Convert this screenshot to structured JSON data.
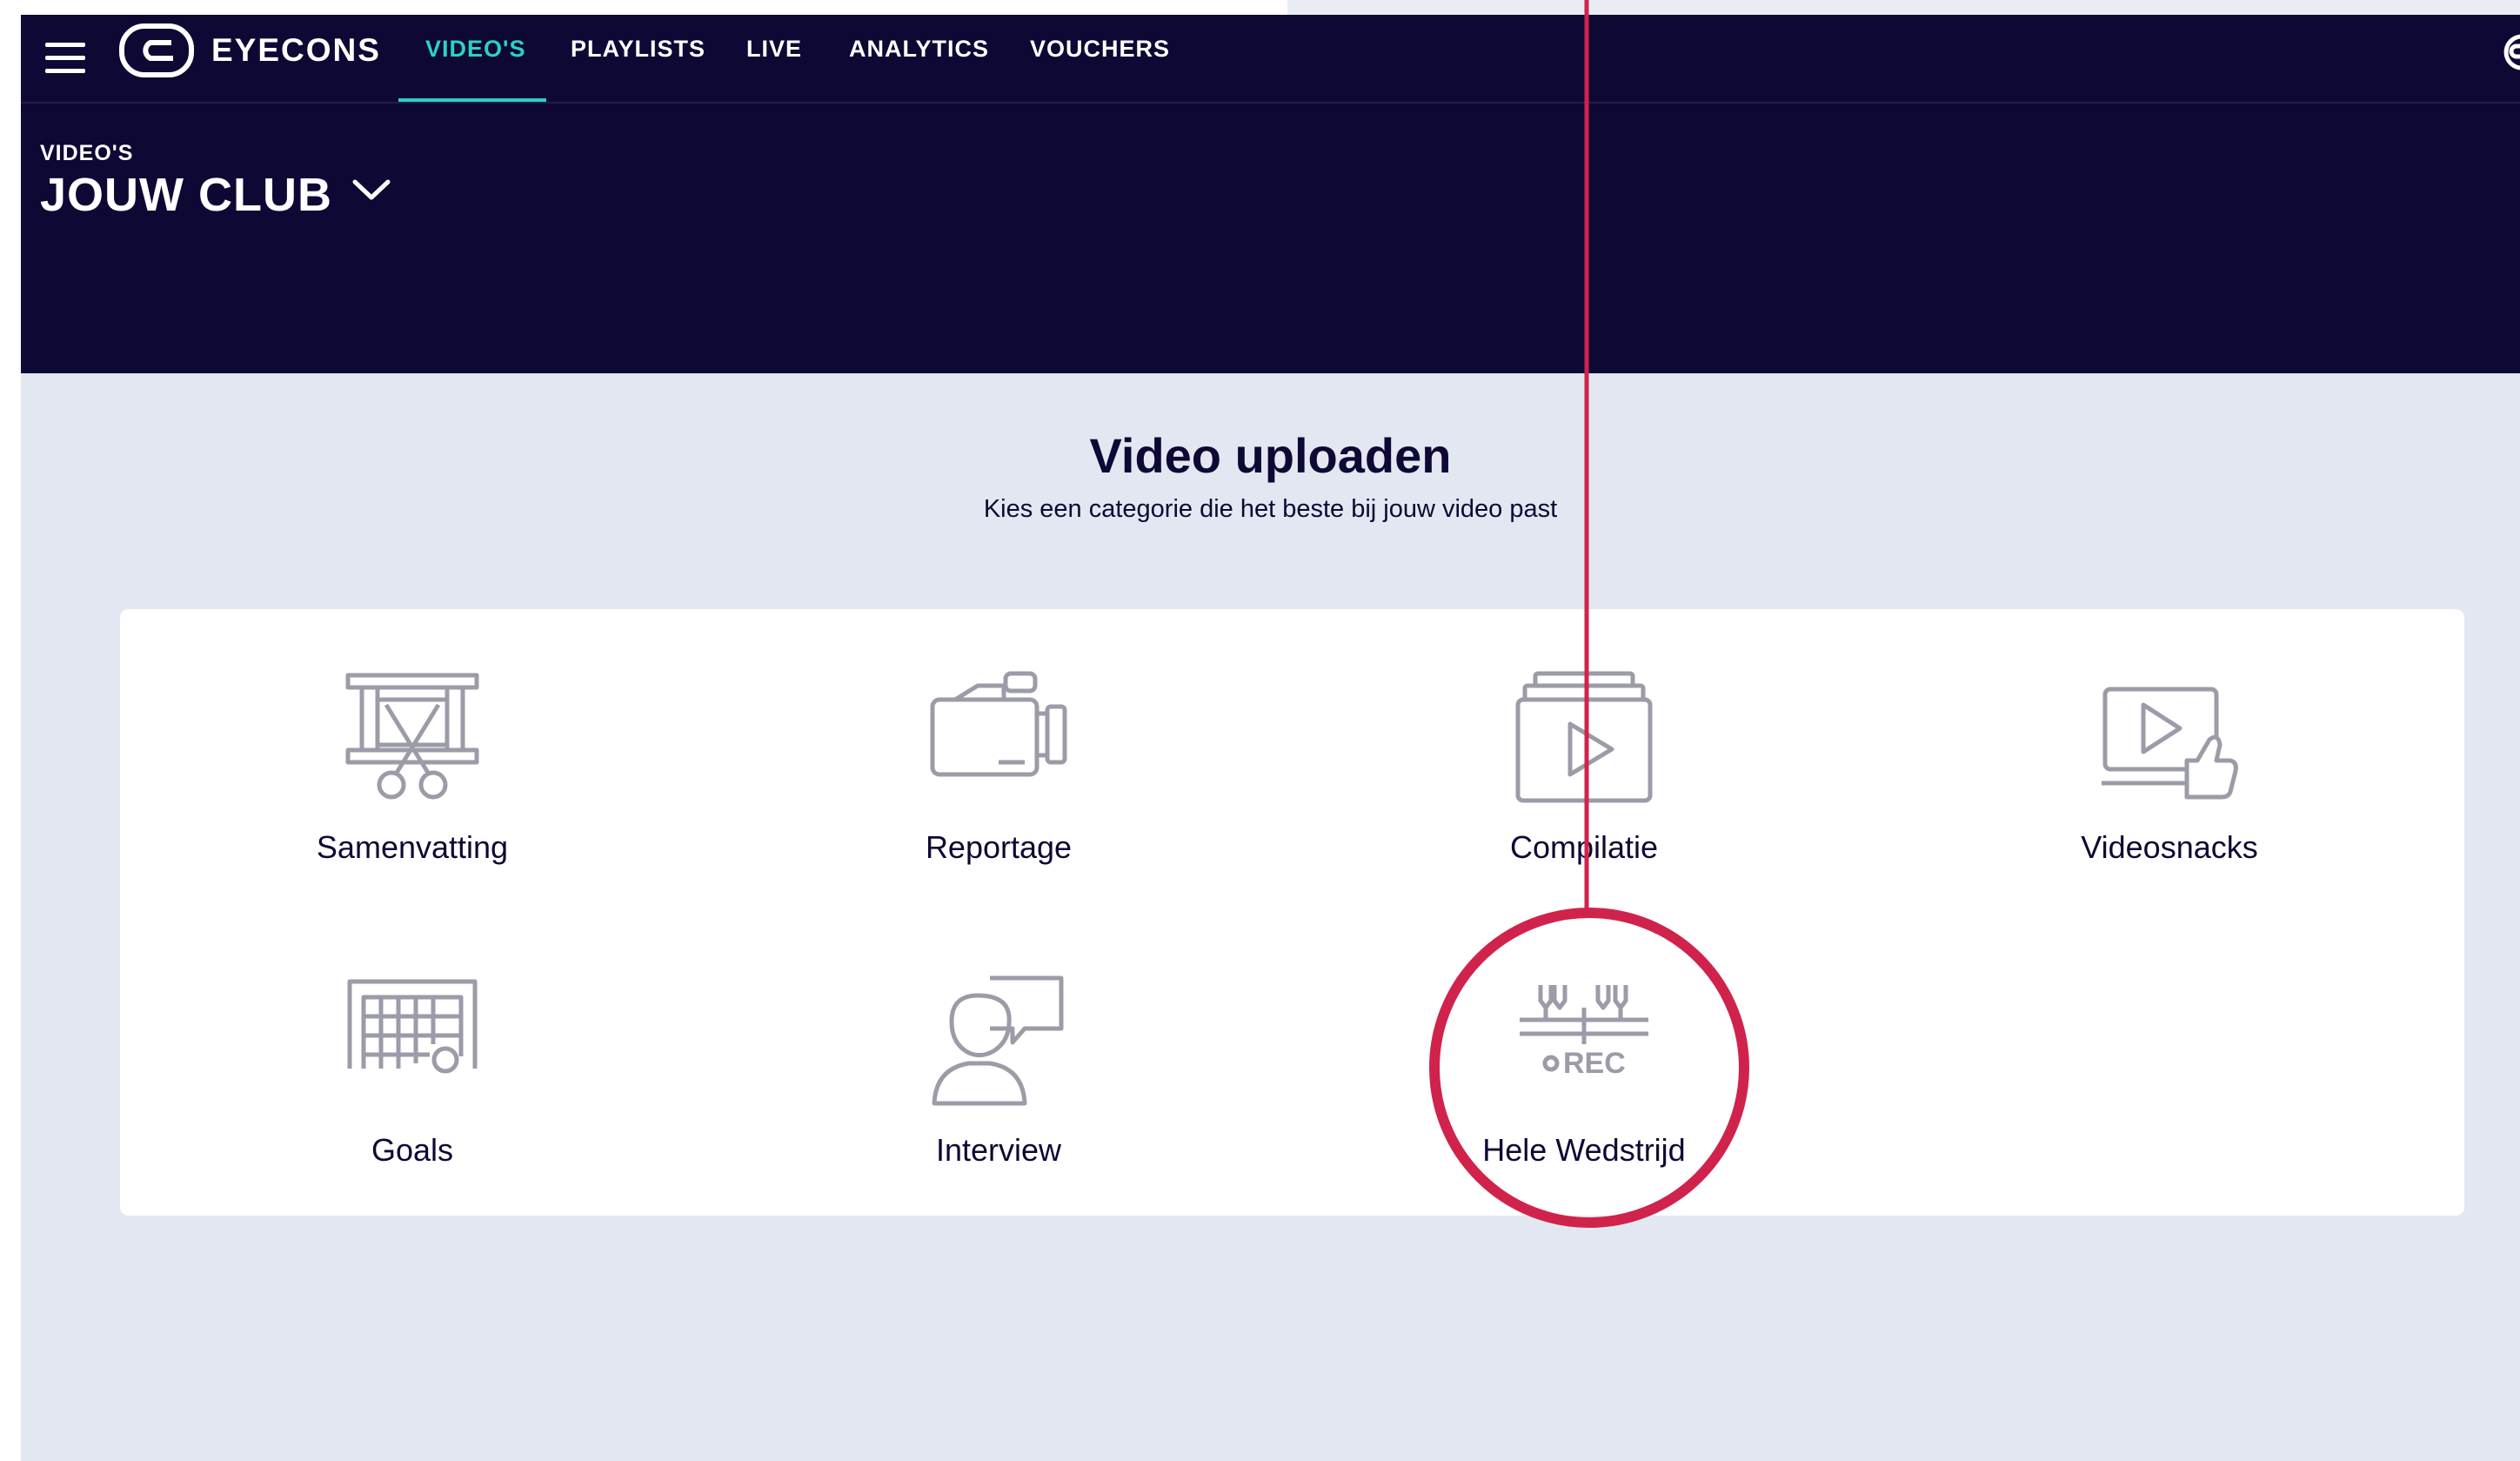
{
  "nav": {
    "brand": "EYECONS",
    "tabs": [
      {
        "label": "VIDEO'S"
      },
      {
        "label": "PLAYLISTS"
      },
      {
        "label": "LIVE"
      },
      {
        "label": "ANALYTICS"
      },
      {
        "label": "VOUCHERS"
      }
    ],
    "active_tab": "VIDEO'S"
  },
  "header": {
    "section": "VIDEO'S",
    "club": "JOUW CLUB"
  },
  "upload": {
    "title": "Video uploaden",
    "subtitle": "Kies een categorie die het beste bij jouw video past"
  },
  "categories": [
    {
      "label": "Samenvatting",
      "icon": "film-scissors-icon"
    },
    {
      "label": "Reportage",
      "icon": "video-camera-icon"
    },
    {
      "label": "Compilatie",
      "icon": "stacked-play-icon"
    },
    {
      "label": "Videosnacks",
      "icon": "play-thumbs-up-icon"
    },
    {
      "label": "Goals",
      "icon": "goal-net-icon"
    },
    {
      "label": "Interview",
      "icon": "person-speech-icon"
    },
    {
      "label": "Hele Wedstrijd",
      "icon": "record-match-icon",
      "rec_text": "REC"
    }
  ],
  "colors": {
    "navy": "#0e0834",
    "accent": "#2ed0c5",
    "background": "#e3e7f1",
    "icon_stroke": "#9b9ca8",
    "annotation": "#d0234c"
  }
}
